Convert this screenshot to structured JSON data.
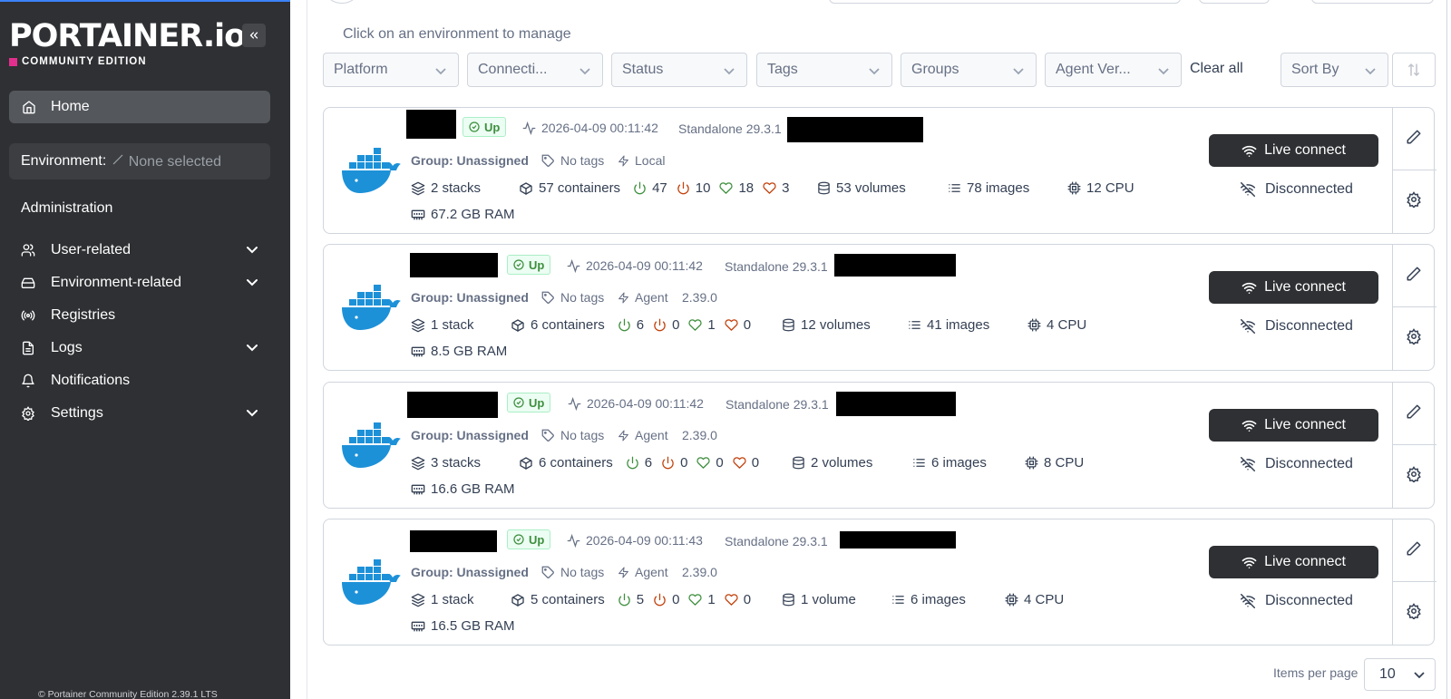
{
  "sidebar": {
    "logo_text": "PORTAINER.io",
    "logo_sub": "COMMUNITY EDITION",
    "home_label": "Home",
    "environment_label": "Environment:",
    "environment_value": "None selected",
    "admin_heading": "Administration",
    "items": [
      {
        "label": "User-related",
        "expandable": true
      },
      {
        "label": "Environment-related",
        "expandable": true
      },
      {
        "label": "Registries",
        "expandable": false
      },
      {
        "label": "Logs",
        "expandable": true
      },
      {
        "label": "Notifications",
        "expandable": false
      },
      {
        "label": "Settings",
        "expandable": true
      }
    ],
    "footer": "© Portainer Community Edition 2.39.1 LTS"
  },
  "main": {
    "hint": "Click on an environment to manage",
    "filters": {
      "platform": "Platform",
      "connection": "Connecti...",
      "status": "Status",
      "tags": "Tags",
      "groups": "Groups",
      "agent_version": "Agent Ver...",
      "clear_all": "Clear all",
      "sort_by": "Sort By"
    },
    "live_connect_label": "Live connect",
    "disconnected_label": "Disconnected",
    "environments": [
      {
        "status": "Up",
        "heartbeat": "2026-04-09 00:11:42",
        "version": "Standalone 29.3.1",
        "group": "Group: Unassigned",
        "tags": "No tags",
        "type": "Local",
        "agent_version": "",
        "stacks": "2 stacks",
        "containers": "57 containers",
        "running": "47",
        "stopped": "10",
        "healthy": "18",
        "unhealthy": "3",
        "volumes": "53 volumes",
        "images": "78 images",
        "cpu": "12 CPU",
        "ram": "67.2 GB RAM"
      },
      {
        "status": "Up",
        "heartbeat": "2026-04-09 00:11:42",
        "version": "Standalone 29.3.1",
        "group": "Group: Unassigned",
        "tags": "No tags",
        "type": "Agent",
        "agent_version": "2.39.0",
        "stacks": "1 stack",
        "containers": "6 containers",
        "running": "6",
        "stopped": "0",
        "healthy": "1",
        "unhealthy": "0",
        "volumes": "12 volumes",
        "images": "41 images",
        "cpu": "4 CPU",
        "ram": "8.5 GB RAM"
      },
      {
        "status": "Up",
        "heartbeat": "2026-04-09 00:11:42",
        "version": "Standalone 29.3.1",
        "group": "Group: Unassigned",
        "tags": "No tags",
        "type": "Agent",
        "agent_version": "2.39.0",
        "stacks": "3 stacks",
        "containers": "6 containers",
        "running": "6",
        "stopped": "0",
        "healthy": "0",
        "unhealthy": "0",
        "volumes": "2 volumes",
        "images": "6 images",
        "cpu": "8 CPU",
        "ram": "16.6 GB RAM"
      },
      {
        "status": "Up",
        "heartbeat": "2026-04-09 00:11:43",
        "version": "Standalone 29.3.1",
        "group": "Group: Unassigned",
        "tags": "No tags",
        "type": "Agent",
        "agent_version": "2.39.0",
        "stacks": "1 stack",
        "containers": "5 containers",
        "running": "5",
        "stopped": "0",
        "healthy": "1",
        "unhealthy": "0",
        "volumes": "1 volume",
        "images": "6 images",
        "cpu": "4 CPU",
        "ram": "16.5 GB RAM"
      }
    ],
    "items_per_page_label": "Items per page",
    "items_per_page_value": "10"
  },
  "colors": {
    "sidebar_bg": "#2e3033",
    "accent_pink": "#e22f8e",
    "docker_blue": "#1d91d8",
    "status_green": "#3e8f3e",
    "stopped_red": "#c2410c"
  }
}
